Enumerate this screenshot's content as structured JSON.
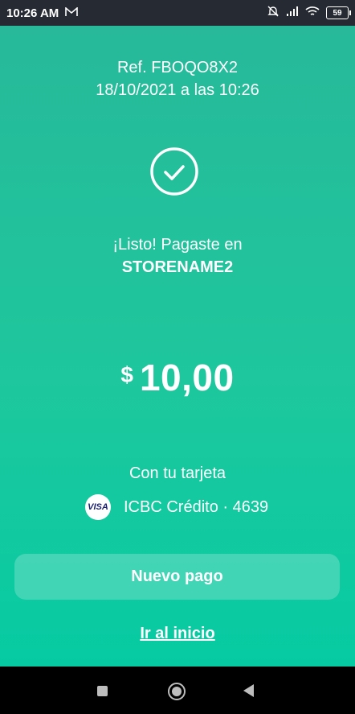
{
  "status_bar": {
    "time": "10:26 AM",
    "mail_icon": "gmail-icon",
    "battery": "59",
    "icons": [
      "mute-icon",
      "signal-icon",
      "wifi-icon",
      "battery-icon"
    ]
  },
  "receipt": {
    "reference": "Ref. FBOQO8X2",
    "datetime": "18/10/2021 a las 10:26",
    "success_message": "¡Listo! Pagaste en",
    "store_name": "STORENAME2",
    "currency": "$",
    "amount": "10,00",
    "card_label": "Con tu tarjeta",
    "card_brand": "VISA",
    "card_info": "ICBC Crédito · 4639"
  },
  "actions": {
    "new_payment": "Nuevo pago",
    "go_home": "Ir al inicio"
  },
  "colors": {
    "accent_top": "#27b99a",
    "accent_bottom": "#06cba2",
    "status_bar": "#252a33"
  }
}
